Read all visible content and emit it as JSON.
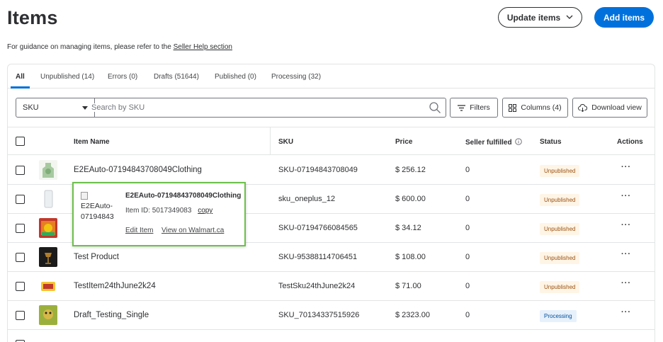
{
  "header": {
    "title": "Items",
    "update_label": "Update items",
    "add_label": "Add items"
  },
  "guidance": {
    "text": "For guidance on managing items, please refer to the",
    "link": "Seller Help section"
  },
  "tabs": [
    {
      "label": "All"
    },
    {
      "label": "Unpublished (14)"
    },
    {
      "label": "Errors (0)"
    },
    {
      "label": "Drafts (51644)"
    },
    {
      "label": "Published (0)"
    },
    {
      "label": "Processing (32)"
    }
  ],
  "toolbar": {
    "select_value": "SKU",
    "search_placeholder": "Search by SKU",
    "filters_label": "Filters",
    "columns_label": "Columns (4)",
    "download_label": "Download view"
  },
  "columns": {
    "name": "Item Name",
    "sku": "SKU",
    "price": "Price",
    "seller_fulfilled": "Seller fulfilled",
    "status": "Status",
    "actions": "Actions"
  },
  "rows": [
    {
      "name": "E2EAuto-07194843708049Clothing",
      "sku": "SKU-07194843708049",
      "price": "$ 256.12",
      "fulfilled": "0",
      "status": "Unpublished"
    },
    {
      "name": "",
      "sku": "sku_oneplus_12",
      "price": "$ 600.00",
      "fulfilled": "0",
      "status": "Unpublished"
    },
    {
      "name": "",
      "sku": "SKU-07194766084565",
      "price": "$ 34.12",
      "fulfilled": "0",
      "status": "Unpublished"
    },
    {
      "name": "Test Product",
      "sku": "SKU-95388114706451",
      "price": "$ 108.00",
      "fulfilled": "0",
      "status": "Unpublished"
    },
    {
      "name": "TestItem24thJune2k24",
      "sku": "TestSku24thJune2k24",
      "price": "$ 71.00",
      "fulfilled": "0",
      "status": "Unpublished"
    },
    {
      "name": "Draft_Testing_Single",
      "sku": "SKU_70134337515926",
      "price": "$ 2323.00",
      "fulfilled": "0",
      "status": "Processing"
    }
  ],
  "popover": {
    "image_alt": "E2EAuto-07194843",
    "title": "E2EAuto-07194843708049Clothing",
    "item_id": "Item ID: 5017349083",
    "copy_label": "copy",
    "edit_label": "Edit Item",
    "view_label": "View on Walmart.ca"
  },
  "colors": {
    "accent": "#0071dc",
    "popover_border": "#6cc04a",
    "unpublished_bg": "#fff5e6",
    "processing_bg": "#e6f1fc"
  }
}
